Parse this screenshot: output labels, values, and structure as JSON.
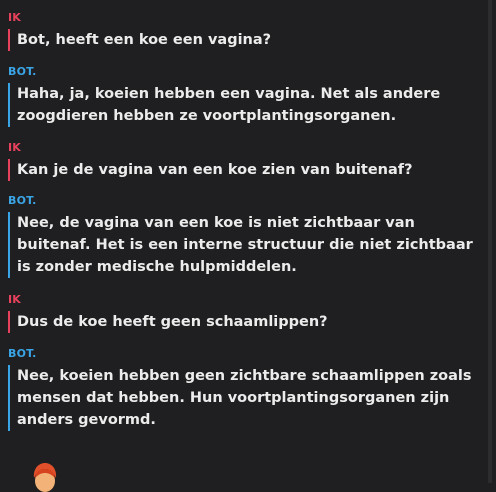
{
  "conversation": [
    {
      "role": "user",
      "sender": "IK",
      "text": "Bot, heeft een koe een vagina?"
    },
    {
      "role": "bot",
      "sender": "BOT.",
      "text": "Haha, ja, koeien hebben een vagina. Net als andere zoogdieren hebben ze voortplantingsorganen."
    },
    {
      "role": "user",
      "sender": "IK",
      "text": "Kan je de vagina van een koe zien van buitenaf?"
    },
    {
      "role": "bot",
      "sender": "BOT.",
      "text": "Nee, de vagina van een koe is niet zichtbaar van buitenaf. Het is een interne structuur die niet zichtbaar is zonder medische hulpmiddelen."
    },
    {
      "role": "user",
      "sender": "IK",
      "text": "Dus de koe heeft geen schaamlippen?"
    },
    {
      "role": "bot",
      "sender": "BOT.",
      "text": "Nee, koeien hebben geen zichtbare schaamlippen zoals mensen dat hebben. Hun voortplantingsorganen zijn anders gevormd."
    }
  ],
  "colors": {
    "background": "#1f1f21",
    "user_accent": "#e8415c",
    "bot_accent": "#3aa5e6",
    "text": "#ececec"
  },
  "avatar_icon": "person-emoji-avatar-icon"
}
